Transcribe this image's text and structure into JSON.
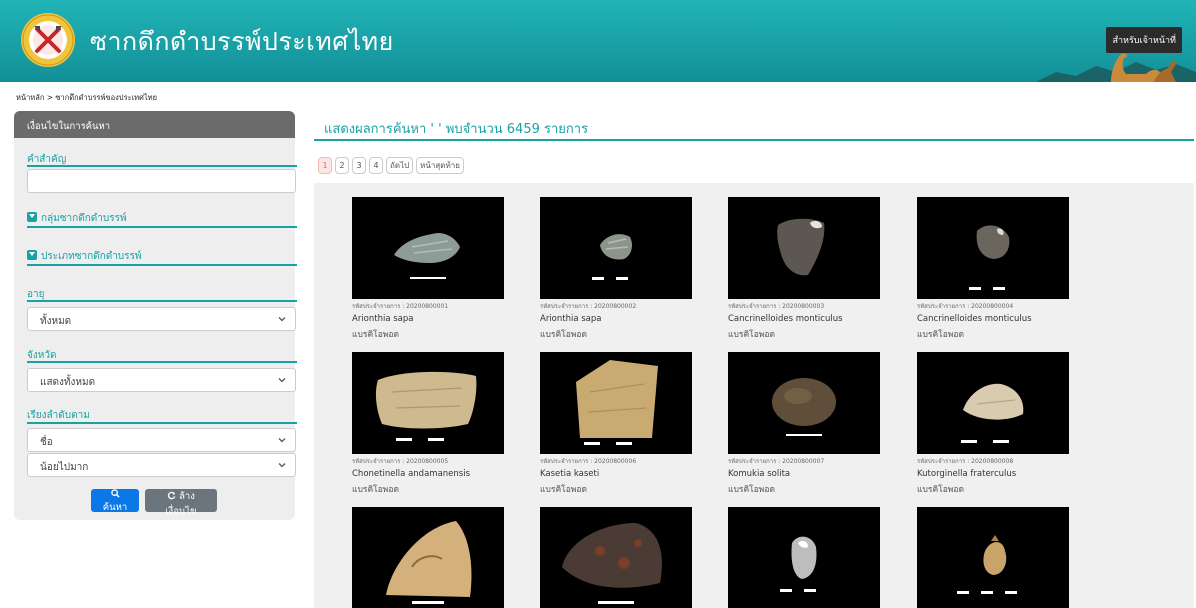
{
  "header": {
    "title": "ซากดึกดำบรรพ์ประเทศไทย",
    "staff_label": "สำหรับเจ้าหน้าที่"
  },
  "breadcrumb": "หน้าหลัก > ซากดึกดำบรรพ์ของประเทศไทย",
  "sidebar": {
    "title": "เงื่อนไขในการค้นหา",
    "keyword_label": "คำสำคัญ",
    "keyword_value": "",
    "group_label": "กลุ่มซากดึกดำบรรพ์",
    "type_label": "ประเภทซากดึกดำบรรพ์",
    "age_label": "อายุ",
    "age_value": "ทั้งหมด",
    "province_label": "จังหวัด",
    "province_value": "แสดงทั้งหมด",
    "sort_label": "เรียงลำดับตาม",
    "sort_field_value": "ชื่อ",
    "sort_order_value": "น้อยไปมาก",
    "search_label": "ค้นหา",
    "clear_label": "ล้างเงื่อนไข"
  },
  "results": {
    "title": "แสดงผลการค้นหา ' ' พบจำนวน 6459 รายการ",
    "pages": [
      "1",
      "2",
      "3",
      "4",
      "ถัดไป",
      "หน้าสุดท้าย"
    ],
    "active_page": "1"
  },
  "items": [
    {
      "code": "รหัสประจำรายการ : 20200800001",
      "name": "Arionthia sapa",
      "group": "แบรคิโอพอด"
    },
    {
      "code": "รหัสประจำรายการ : 20200800002",
      "name": "Arionthia sapa",
      "group": "แบรคิโอพอด"
    },
    {
      "code": "รหัสประจำรายการ : 20200800003",
      "name": "Cancrinelloides monticulus",
      "group": "แบรคิโอพอด"
    },
    {
      "code": "รหัสประจำรายการ : 20200800004",
      "name": "Cancrinelloides monticulus",
      "group": "แบรคิโอพอด"
    },
    {
      "code": "รหัสประจำรายการ : 20200800005",
      "name": "Chonetinella andamanensis",
      "group": "แบรคิโอพอด"
    },
    {
      "code": "รหัสประจำรายการ : 20200800006",
      "name": "Kasetia kaseti",
      "group": "แบรคิโอพอด"
    },
    {
      "code": "รหัสประจำรายการ : 20200800007",
      "name": "Komukia solita",
      "group": "แบรคิโอพอด"
    },
    {
      "code": "รหัสประจำรายการ : 20200800008",
      "name": "Kutorginella fraterculus",
      "group": "แบรคิโอพอด"
    },
    {
      "code": "",
      "name": "",
      "group": ""
    },
    {
      "code": "",
      "name": "",
      "group": ""
    },
    {
      "code": "",
      "name": "",
      "group": ""
    },
    {
      "code": "",
      "name": "",
      "group": ""
    }
  ],
  "colors": {
    "teal": "#17a2a6",
    "header": "#1aa8ac",
    "search": "#0a78e6",
    "clear": "#6c757d"
  }
}
